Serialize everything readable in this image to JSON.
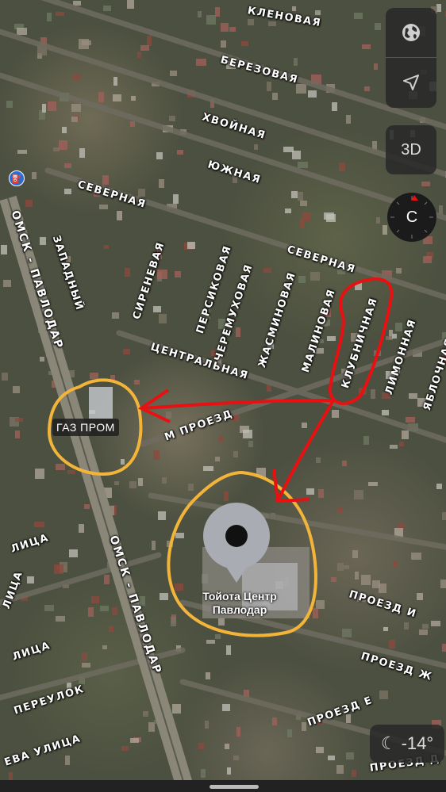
{
  "streets": {
    "klenovaya": "КЛЕНОВАЯ",
    "berezovaya": "БЕРЕЗОВАЯ",
    "khvoynaya": "ХВОЙНАЯ",
    "yuzhnaya": "ЮЖНАЯ",
    "severnaya_west": "СЕВЕРНАЯ",
    "severnaya_east": "СЕВЕРНАЯ",
    "zapadny": "ЗАПАДНЫЙ",
    "sirenevaya": "СИРЕНЕВАЯ",
    "persikovaya": "ПЕРСИКОВАЯ",
    "cheremukhovaya": "ЧЕРЕМУХОВАЯ",
    "zhasminovaya": "ЖАСМИНОВАЯ",
    "malinovaya": "МАЛИНОВАЯ",
    "klubnichnaya": "КЛУБНИЧНАЯ",
    "limonnaya": "ЛИМОННАЯ",
    "yablochnaya": "ЯБЛОЧНАЯ",
    "tsentralnaya": "ЦЕНТРАЛЬНАЯ",
    "m_proezd": "М ПРОЕЗД",
    "proezd_i": "ПРОЕЗД И",
    "proezd_zh": "ПРОЕЗД Ж",
    "proezd_e": "ПРОЕЗД Е",
    "proezd_d": "ПРОЕЗД Д",
    "ulitsa_1": "ЛИЦА",
    "ulitsa_2": "ЛИЦА",
    "ulitsa_3": "ЛИЦА",
    "pereulok": "ПЕРЕУЛОК",
    "eva_ulitsa": "ЕВА УЛИЦА",
    "highway_top": "ОМСК - ПАВЛОДАР",
    "highway_bottom": "ОМСК - ПАВЛОДАР"
  },
  "pois": {
    "gazprom": "ГАЗ ПРОМ",
    "toyota": "Тойота Центр Павлодар"
  },
  "controls": {
    "globe_icon": "globe-icon",
    "location_icon": "location-arrow-icon",
    "three_d": "3D",
    "compass": "С"
  },
  "weather": {
    "icon": "moon-stars-icon",
    "temperature": "-14°"
  },
  "colors": {
    "annotation_red": "#e81010",
    "annotation_yellow": "#f3b43a",
    "pin_gray": "#a9acb3",
    "pin_center": "#111111"
  }
}
